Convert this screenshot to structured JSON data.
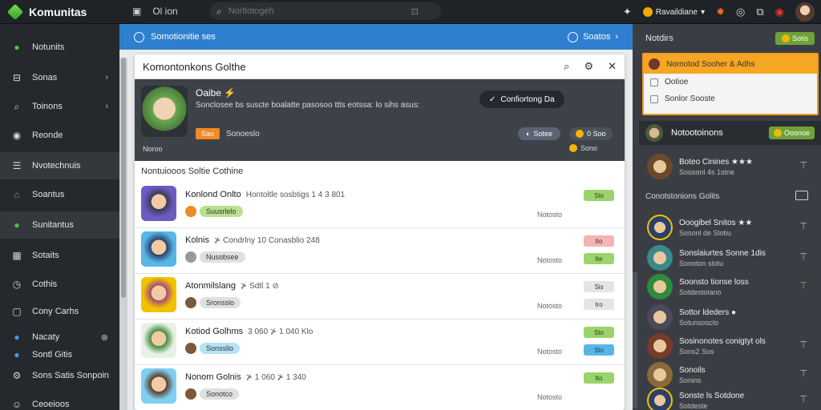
{
  "topbar": {
    "brand": "Komunitas",
    "search_placeholder": "Nortlotogeh",
    "left_icons": [
      "window-icon",
      "columns-icon"
    ],
    "left_text": "Ol  ion",
    "lang_label": "Ravaildiane",
    "right_icons": [
      "puzzle-icon",
      "star-icon",
      "target-icon",
      "edit-icon",
      "record-icon"
    ]
  },
  "sidebar": {
    "items": [
      {
        "label": "Notunits",
        "icon": "green-dot-icon"
      },
      {
        "label": "Sonas",
        "icon": "inbox-icon",
        "chevron": true
      },
      {
        "label": "Toinons",
        "icon": "search-icon",
        "chevron": true
      },
      {
        "label": "Reonde",
        "icon": "record-icon"
      },
      {
        "label": "Nvotechnuis",
        "icon": "list-icon",
        "active": true
      },
      {
        "label": "Soantus",
        "icon": "home-icon"
      },
      {
        "label": "Sunitantus",
        "icon": "green-chat-icon",
        "active": true
      },
      {
        "label": "Sotaits",
        "icon": "grid-icon"
      },
      {
        "label": "Cothis",
        "icon": "clock-icon"
      },
      {
        "label": "Cony Carhs",
        "icon": "box-icon"
      },
      {
        "label": "Nacaty",
        "icon": "blue-dot-icon",
        "close": true
      },
      {
        "label": "Sontl Gitis",
        "icon": "blue-dot-icon"
      },
      {
        "label": "Sons Satis Sonpoin",
        "icon": "gear-icon"
      },
      {
        "label": "Ceoeioos",
        "icon": "users-icon"
      }
    ]
  },
  "banner": {
    "left": "Somotionitie ses",
    "right": "Soatos"
  },
  "panel": {
    "title": "Komontonkons Golthe",
    "hero": {
      "title": "Oaibe ⚡",
      "desc": "Sonclosee bs suscte boalatte pasosoo ttts eotssa: lo sihs asus:",
      "tag": "Sao",
      "tag2": "Sonoeslo",
      "foot": "Noroo",
      "btn": "Confiortong Da",
      "stat1": "Sotee",
      "stat2": "0 Soo",
      "stat3": "Sono"
    },
    "section": "Nontuiooos Soltie Cothine",
    "rows": [
      {
        "name": "Konlond Onlto",
        "meta": "Hontoltle sosbtigs 1 4 3  801",
        "label": "Suusrlelo",
        "time": "Notosto",
        "chip1": "Sto",
        "chip2": "",
        "chip1_color": "#9ad46a",
        "chip2_color": ""
      },
      {
        "name": "Kolnis",
        "meta": "⊁ Condrlny 10  Conasblio  248",
        "label": "Nusobsee",
        "time": "Notosto",
        "chip1": "Ito",
        "chip2": "Ite",
        "chip1_color": "#f2b4b4",
        "chip2_color": "#9ad46a"
      },
      {
        "name": "Atonmilslang",
        "meta": "⊁ Sdtl 1 ⊘",
        "label": "Sronsslo",
        "time": "Notosto",
        "chip1": "Sis",
        "chip2": "Iro",
        "chip1_color": "#e5e5e5",
        "chip2_color": "#e5e5e5"
      },
      {
        "name": "Kotiod Golhms",
        "meta": "3 060 ⊁ 1 040 Klo",
        "label": "Sonsslio",
        "time": "Notosto",
        "chip1": "Sto",
        "chip2": "Slo",
        "chip1_color": "#9ad46a",
        "chip2_color": "#56b6e6"
      },
      {
        "name": "Nonom Golnis",
        "meta": "⊁ 1 060 ⊁ 1 340",
        "label": "Sonotco",
        "time": "Notosto",
        "chip1": "Ito",
        "chip2": "",
        "chip1_color": "#9ad46a",
        "chip2_color": ""
      }
    ]
  },
  "right": {
    "head": "Notdirs",
    "head_btn": "Sotis",
    "card_title": "Nornotod Sooher & Adhs",
    "card_lines": [
      "Ootioe",
      "Sonlor Sooste"
    ],
    "bar_title": "Notootoinons",
    "bar_btn": "Ooonoe",
    "section2": "Conotstonions Golits",
    "people": [
      {
        "name": "Boteo Cinines ★★★",
        "sub": "Soosonl 4s 1stne"
      },
      {
        "name": "Ooogibel Snitos ★★",
        "sub": "Sosonl de  Slotiu"
      },
      {
        "name": "Sonslaiurtes Sonne 1dis",
        "sub": "Sonoton slotu"
      },
      {
        "name": "Soonsto tionse loss",
        "sub": "Sotdestoiano"
      },
      {
        "name": "Sottor ldeders ●",
        "sub": "Sotunsosclo"
      },
      {
        "name": "Sosinonotes conigtyt ols",
        "sub": "Sons2 Sos"
      },
      {
        "name": "Sonoils",
        "sub": "Sonins"
      },
      {
        "name": "Sonste ls Sotdone",
        "sub": "Sotdeste"
      }
    ]
  }
}
